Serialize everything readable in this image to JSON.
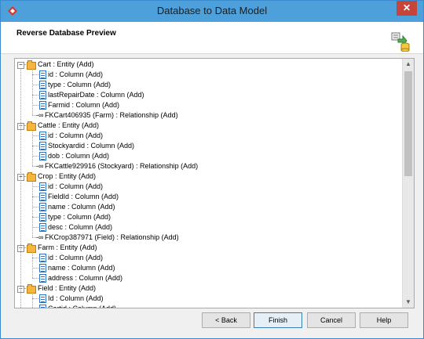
{
  "window": {
    "title": "Database to Data Model",
    "close_label": "✕"
  },
  "header": {
    "title": "Reverse Database Preview"
  },
  "tree": [
    {
      "type": "entity",
      "label": "Cart : Entity (Add)"
    },
    {
      "type": "column",
      "label": "id : Column (Add)"
    },
    {
      "type": "column",
      "label": "type : Column (Add)"
    },
    {
      "type": "column",
      "label": "lastRepairDate : Column (Add)"
    },
    {
      "type": "column",
      "label": "Farmid : Column (Add)"
    },
    {
      "type": "relationship",
      "label": "FKCart406935 (Farm) : Relationship (Add)"
    },
    {
      "type": "entity",
      "label": "Cattle : Entity (Add)"
    },
    {
      "type": "column",
      "label": "id : Column (Add)"
    },
    {
      "type": "column",
      "label": "Stockyardid : Column (Add)"
    },
    {
      "type": "column",
      "label": "dob : Column (Add)"
    },
    {
      "type": "relationship",
      "label": "FKCattle929916 (Stockyard) : Relationship (Add)"
    },
    {
      "type": "entity",
      "label": "Crop : Entity (Add)"
    },
    {
      "type": "column",
      "label": "id : Column (Add)"
    },
    {
      "type": "column",
      "label": "FieldId : Column (Add)"
    },
    {
      "type": "column",
      "label": "name : Column (Add)"
    },
    {
      "type": "column",
      "label": "type : Column (Add)"
    },
    {
      "type": "column",
      "label": "desc : Column (Add)"
    },
    {
      "type": "relationship",
      "label": "FKCrop387971 (Field) : Relationship (Add)"
    },
    {
      "type": "entity",
      "label": "Farm : Entity (Add)"
    },
    {
      "type": "column",
      "label": "id : Column (Add)"
    },
    {
      "type": "column",
      "label": "name : Column (Add)"
    },
    {
      "type": "column",
      "label": "address : Column (Add)"
    },
    {
      "type": "entity",
      "label": "Field : Entity (Add)"
    },
    {
      "type": "column",
      "label": "Id : Column (Add)"
    },
    {
      "type": "column",
      "label": "Cartid : Column (Add)"
    }
  ],
  "buttons": {
    "back": "< Back",
    "finish": "Finish",
    "cancel": "Cancel",
    "help": "Help"
  }
}
